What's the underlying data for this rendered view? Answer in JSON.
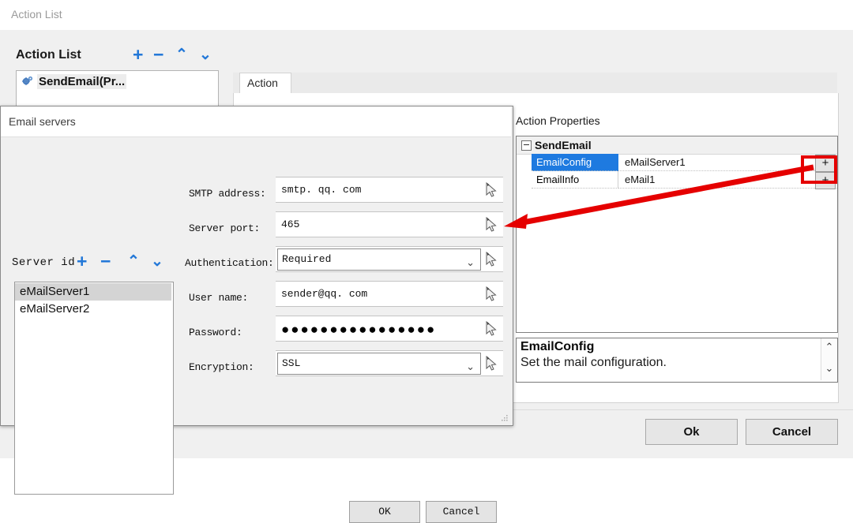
{
  "app": {
    "titlebar": "Action List",
    "action_list_header": "Action List",
    "toolbar": {
      "add": "+",
      "remove": "−",
      "move_up": "⌃",
      "move_down": "⌄"
    },
    "action_items": [
      {
        "label": "SendEmail(Pr...",
        "icon": "gear-icon"
      }
    ],
    "tabs": [
      {
        "label": "Action",
        "active": true
      }
    ],
    "buttons": {
      "ok": "Ok",
      "cancel": "Cancel"
    }
  },
  "action_properties": {
    "title": "Action Properties",
    "group": "SendEmail",
    "rows": [
      {
        "key": "EmailConfig",
        "value": "eMailServer1",
        "button": "+",
        "selected": true,
        "highlighted": true
      },
      {
        "key": "EmailInfo",
        "value": "eMail1",
        "button": "+",
        "selected": false,
        "highlighted": false
      }
    ],
    "description": {
      "title": "EmailConfig",
      "text": "Set the mail configuration.",
      "scroll_up": "⌃",
      "scroll_down": "⌄"
    }
  },
  "email_dialog": {
    "title": "Email servers",
    "server_id_label": "Server id",
    "toolbar": {
      "add": "+",
      "remove": "−",
      "move_up": "⌃",
      "move_down": "⌄"
    },
    "servers": [
      {
        "name": "eMailServer1",
        "selected": true
      },
      {
        "name": "eMailServer2",
        "selected": false
      }
    ],
    "fields": [
      {
        "label": "SMTP address:",
        "value": "smtp. qq. com",
        "type": "text"
      },
      {
        "label": "Server port:",
        "value": "465",
        "type": "text"
      },
      {
        "label": "Authentication:",
        "value": "Required",
        "type": "combo"
      },
      {
        "label": "User name:",
        "value": "sender@qq. com",
        "type": "text"
      },
      {
        "label": "Password:",
        "value": "●●●●●●●●●●●●●●●●",
        "type": "password"
      },
      {
        "label": "Encryption:",
        "value": "SSL",
        "type": "combo"
      }
    ],
    "buttons": {
      "ok": "OK",
      "cancel": "Cancel"
    }
  },
  "colors": {
    "accent_blue": "#2378d8",
    "selection_blue": "#1e7ae0",
    "annotation_red": "#e50000",
    "window_bg": "#f0f0f0"
  }
}
